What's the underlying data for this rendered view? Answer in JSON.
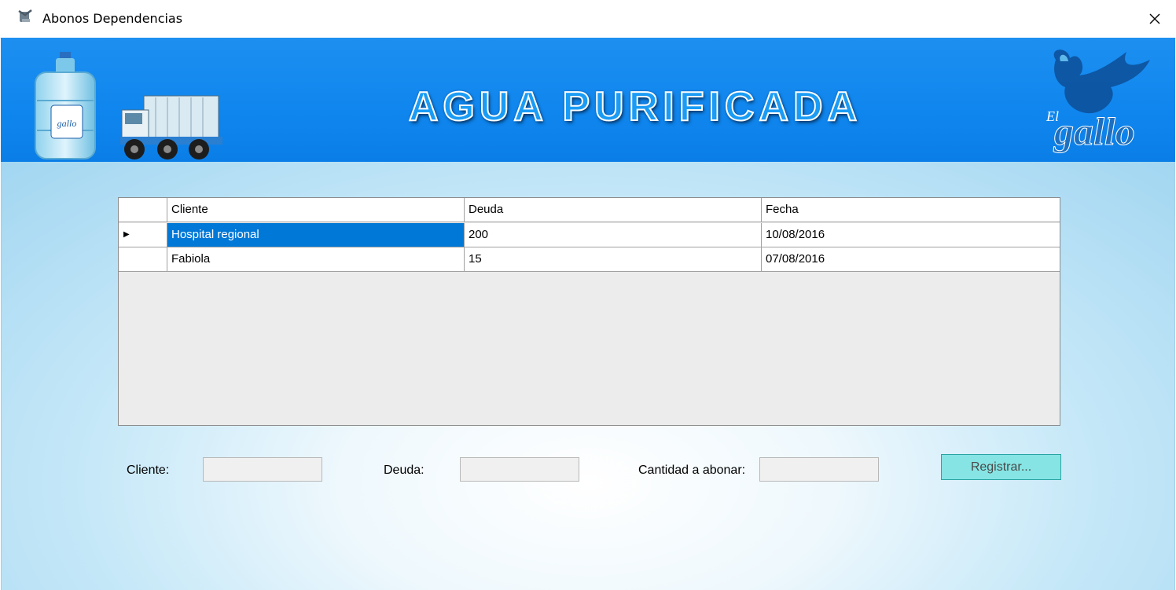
{
  "window": {
    "title": "Abonos Dependencias",
    "close_glyph": "✕"
  },
  "banner": {
    "title": "AGUA PURIFICADA",
    "logo_word_top": "El",
    "logo_word_bottom": "gallo",
    "bottle_label": "gallo"
  },
  "grid": {
    "headers": [
      "Cliente",
      "Deuda",
      "Fecha"
    ],
    "rows": [
      {
        "cliente": "Hospital regional",
        "deuda": "200",
        "fecha": "10/08/2016",
        "selected": true
      },
      {
        "cliente": "Fabiola",
        "deuda": "15",
        "fecha": "07/08/2016",
        "selected": false
      }
    ],
    "row_indicator": "▶"
  },
  "form": {
    "cliente_label": "Cliente:",
    "deuda_label": "Deuda:",
    "cantidad_label": "Cantidad a abonar:",
    "cliente_value": "",
    "deuda_value": "",
    "cantidad_value": "",
    "register_button": "Registrar..."
  },
  "colors": {
    "banner": "#0f86ee",
    "selection": "#0078d7",
    "button": "#86e4e4"
  }
}
